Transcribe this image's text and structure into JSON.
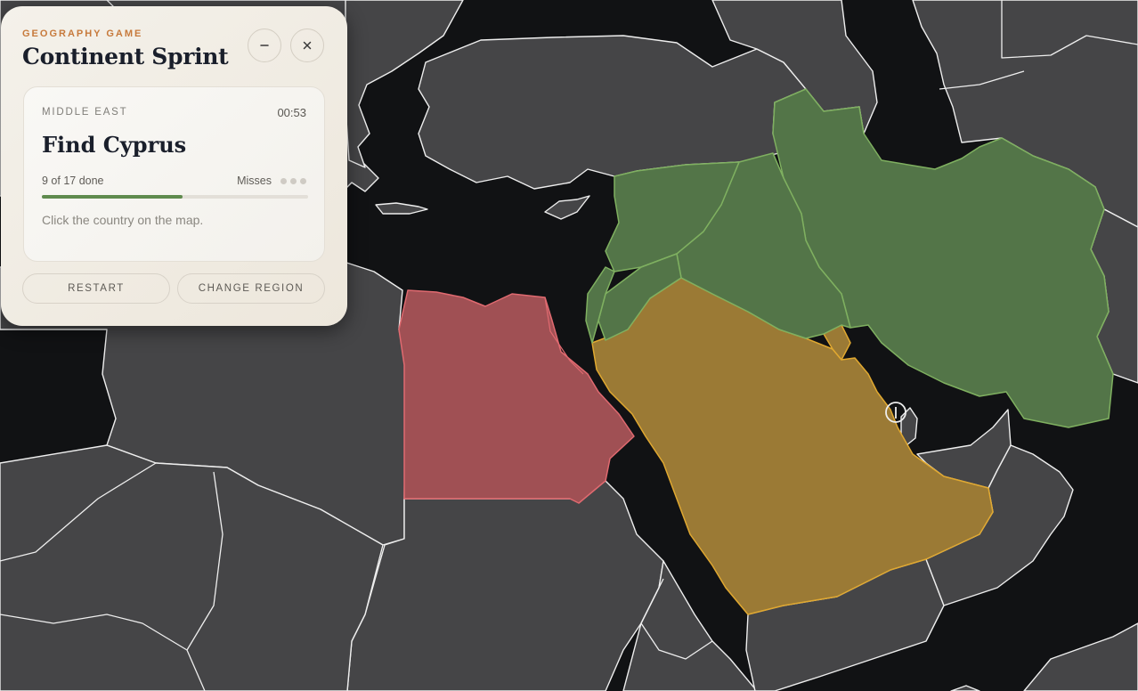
{
  "game": {
    "eyebrow": "GEOGRAPHY GAME",
    "title": "Continent Sprint",
    "minimize_icon": "minus-icon",
    "close_icon": "close-icon"
  },
  "card": {
    "region": "MIDDLE EAST",
    "timer": "00:53",
    "prompt": "Find Cyprus",
    "done_text": "9 of 17 done",
    "progress": 0.529,
    "misses_label": "Misses",
    "misses_total": 3,
    "misses_used": 0,
    "hint": "Click the country on the map."
  },
  "buttons": {
    "restart": "RESTART",
    "change_region": "CHANGE REGION"
  },
  "colors": {
    "accent": "#c77a3c",
    "progress_fill": "#5f8b4e",
    "region_red": "#a05054",
    "region_yellow": "#9b7a35",
    "region_green": "#537548",
    "land": "#454547",
    "water": "#111214"
  }
}
